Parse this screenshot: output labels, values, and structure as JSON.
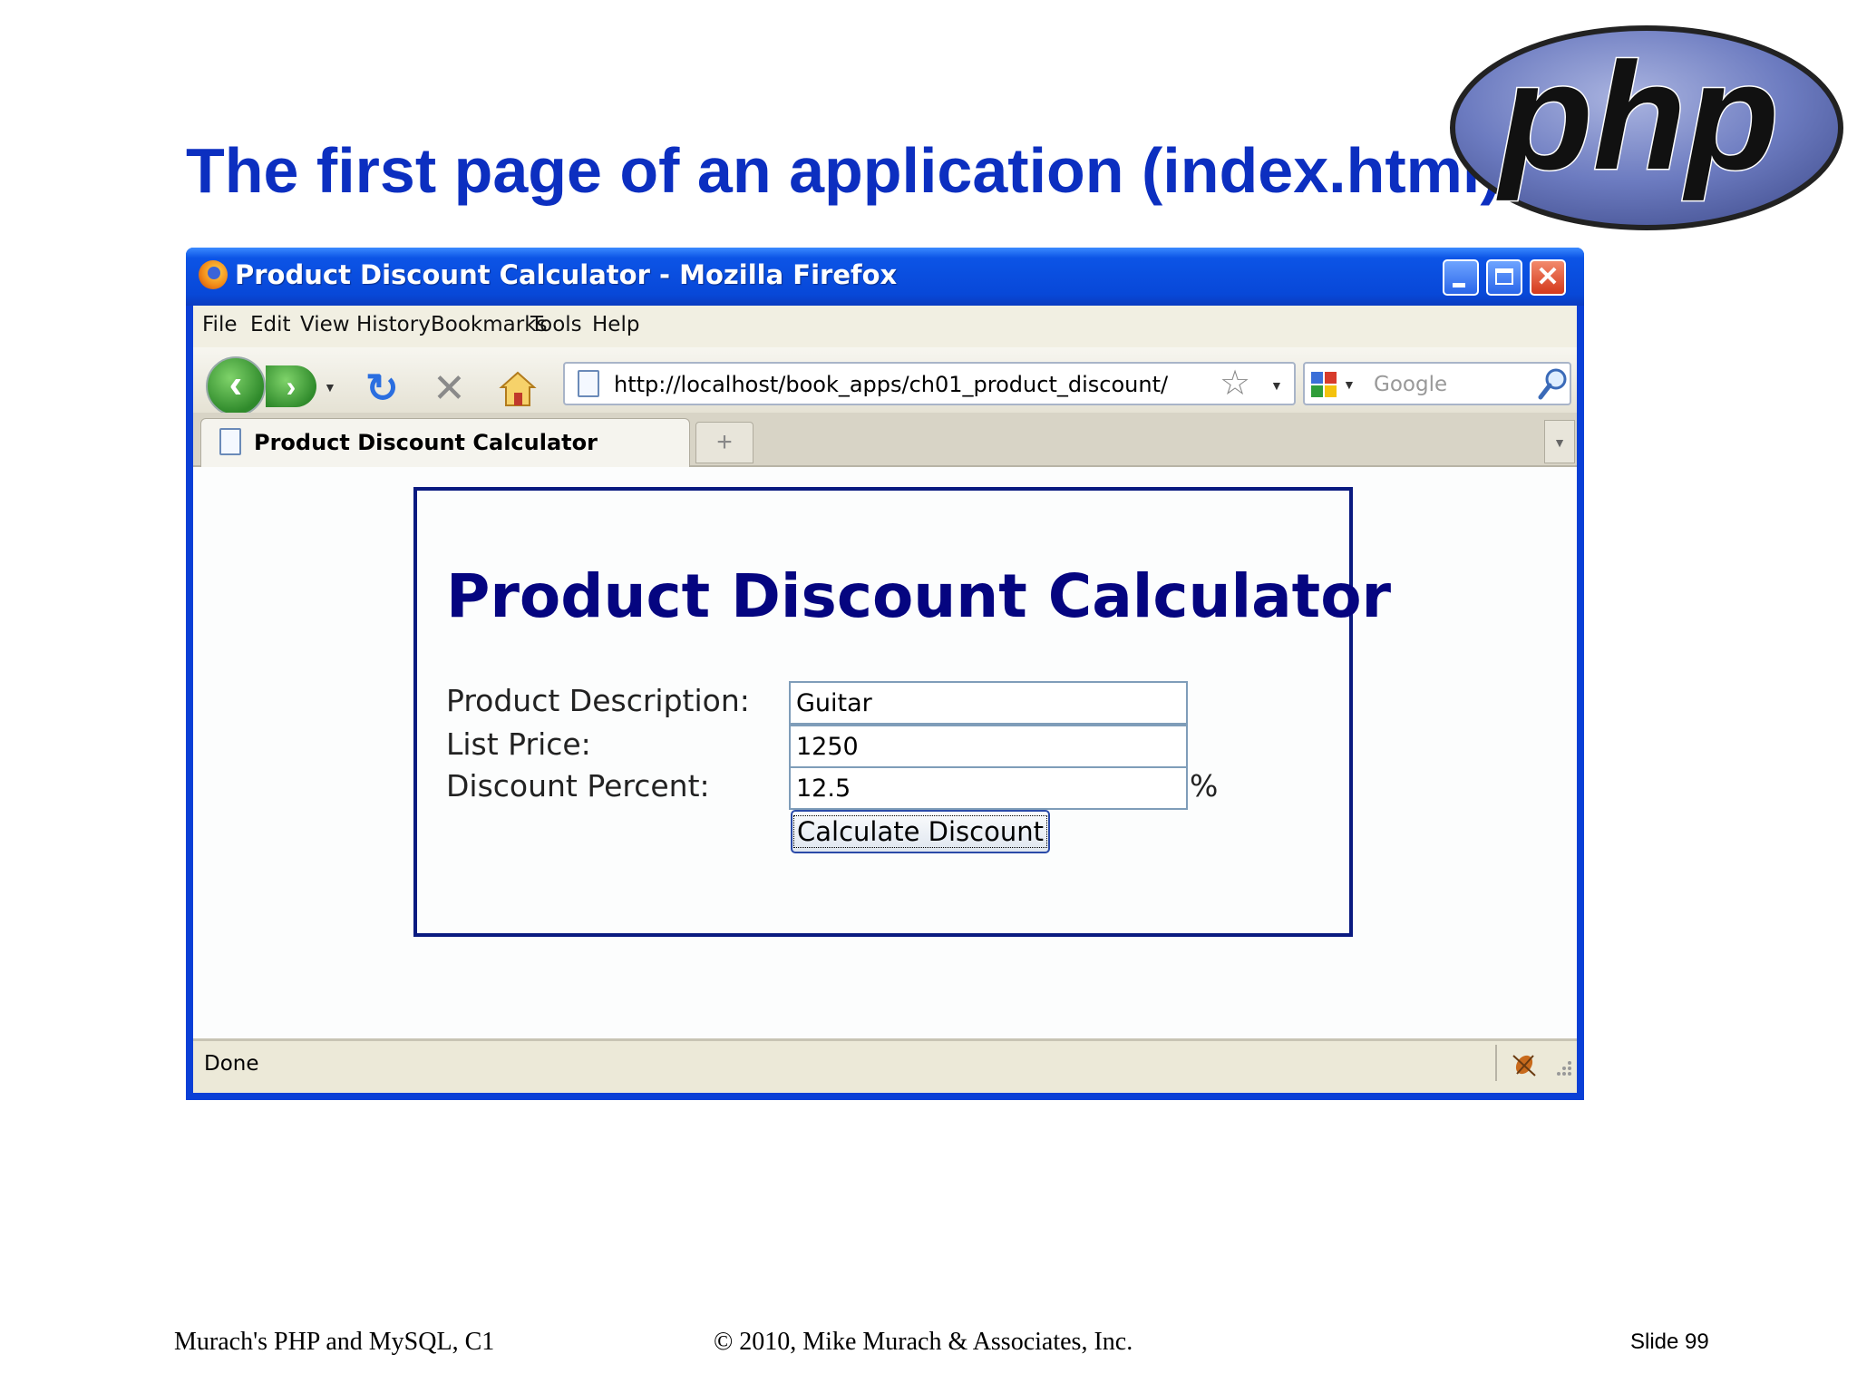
{
  "slide": {
    "title": "The first page of an application (index.html)",
    "logo_text": "php"
  },
  "browser": {
    "window_title": "Product Discount Calculator - Mozilla Firefox",
    "menu": [
      "File",
      "Edit",
      "View",
      "History",
      "Bookmarks",
      "Tools",
      "Help"
    ],
    "url": "http://localhost/book_apps/ch01_product_discount/",
    "search_placeholder": "Google",
    "tab_label": "Product Discount Calculator",
    "new_tab_symbol": "+",
    "status": "Done",
    "icons": [
      "firefox-icon",
      "minimize-icon",
      "maximize-icon",
      "close-icon",
      "back-arrow-icon",
      "forward-arrow-icon",
      "reload-icon",
      "stop-icon",
      "home-icon",
      "page-icon",
      "bookmark-star-icon",
      "google-icon",
      "magnifier-icon",
      "bug-icon",
      "resize-grip-icon"
    ]
  },
  "page": {
    "heading": "Product Discount Calculator",
    "fields": [
      {
        "label": "Product Description:",
        "value": "Guitar"
      },
      {
        "label": "List Price:",
        "value": "1250"
      },
      {
        "label": "Discount Percent:",
        "value": "12.5"
      }
    ],
    "percent_suffix": "%",
    "submit_label": "Calculate Discount"
  },
  "footer": {
    "left": "Murach's PHP and MySQL, C1",
    "center": "© 2010, Mike Murach & Associates, Inc.",
    "right": "Slide 99"
  },
  "colors": {
    "slide_title": "#0c2fc0",
    "window_frame": "#0a3fd6",
    "page_heading": "#050580",
    "php_logo_fill": "#6c7bc0"
  }
}
